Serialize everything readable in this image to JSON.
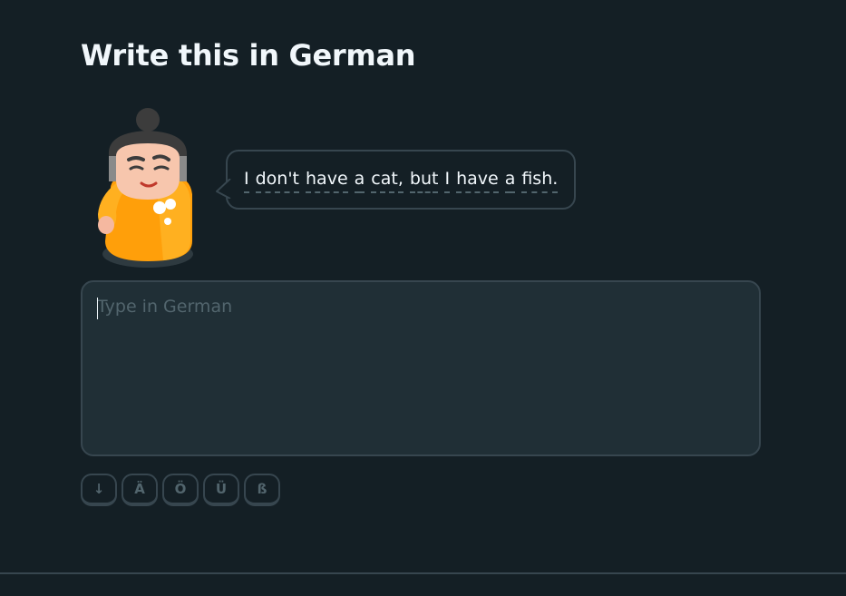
{
  "header": {
    "title": "Write this in German"
  },
  "speaker": {
    "avatar_icon": "character-avatar-icon",
    "prompt_words": [
      "I",
      "don't",
      "have",
      "a",
      "cat,",
      "but",
      "I",
      "have",
      "a",
      "fish."
    ]
  },
  "answer": {
    "placeholder": "Type in German",
    "value": ""
  },
  "special_keys": [
    {
      "label": "↓",
      "icon": "collapse-arrow-icon"
    },
    {
      "label": "Ä"
    },
    {
      "label": "Ö"
    },
    {
      "label": "Ü"
    },
    {
      "label": "ß"
    }
  ],
  "colors": {
    "background": "#141f25",
    "text": "#f1f7fb",
    "border": "#37464f",
    "input_bg": "#202f36",
    "muted": "#52656d",
    "character_orange": "#ff9f0a"
  }
}
